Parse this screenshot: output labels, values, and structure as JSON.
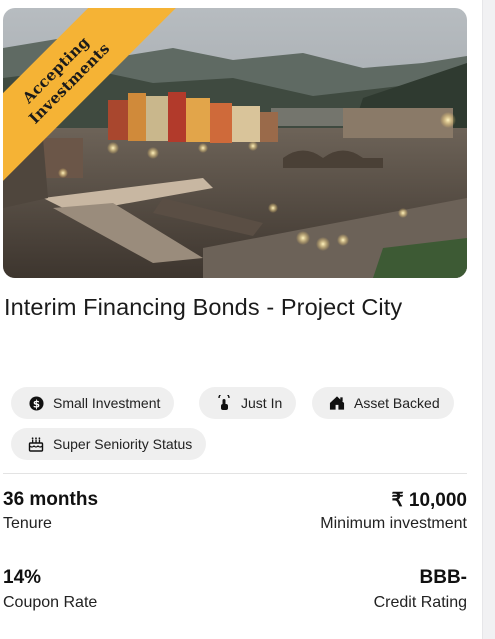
{
  "listing": {
    "badge": {
      "line1": "Accepting",
      "line2": "Investments",
      "color": "#f5b335"
    },
    "title": "Interim Financing Bonds - Project City",
    "tags": [
      {
        "label": "Small Investment",
        "icon": "dollar-coin-icon"
      },
      {
        "label": "Just In",
        "icon": "touch-hand-icon"
      },
      {
        "label": "Asset Backed",
        "icon": "house-icon"
      },
      {
        "label": "Super Seniority Status",
        "icon": "cake-icon"
      }
    ],
    "stats": {
      "tenure": {
        "value": "36 months",
        "label": "Tenure"
      },
      "min_investment": {
        "value": "₹ 10,000",
        "label": "Minimum investment"
      },
      "coupon": {
        "value": "14%",
        "label": "Coupon Rate"
      },
      "rating": {
        "value": "BBB-",
        "label": "Credit Rating"
      }
    }
  }
}
